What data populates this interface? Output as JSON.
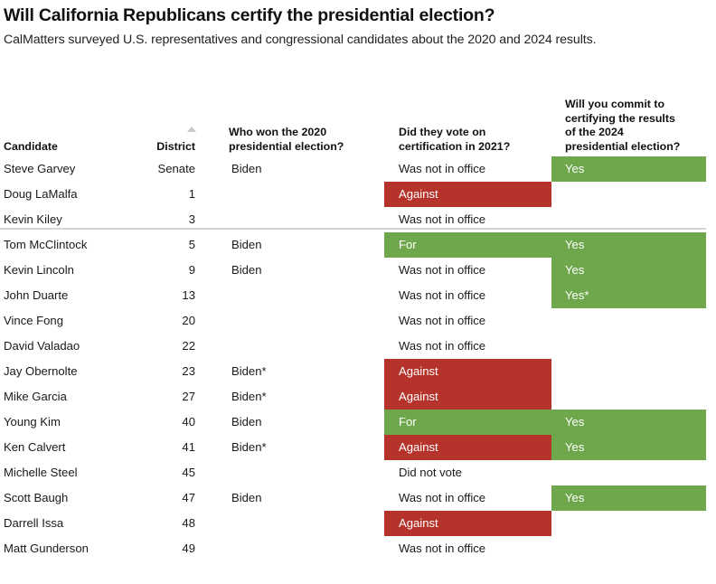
{
  "title": "Will California Republicans certify the presidential election?",
  "subtitle": "CalMatters surveyed U.S. representatives and congressional candidates about the 2020 and 2024 results.",
  "colors": {
    "green": "#6fa74d",
    "red": "#b5332b",
    "rule": "#d5d5d5",
    "sort_caret": "#c9c9c9",
    "text": "#1a1a1a"
  },
  "table": {
    "sort": {
      "column": "District",
      "direction": "ascending",
      "icon": "triangle-up-icon"
    },
    "columns": [
      {
        "key": "candidate",
        "label": "Candidate"
      },
      {
        "key": "district",
        "label": "District"
      },
      {
        "key": "won2020",
        "label": "Who won the 2020 presidential election?"
      },
      {
        "key": "cert2021",
        "label": "Did they vote on certification in 2021?"
      },
      {
        "key": "commit24",
        "label": "Will you commit to certifying the results of the 2024 presidential election?"
      }
    ],
    "column_label_lines": {
      "won2020": [
        "Who won the 2020",
        "presidential election?"
      ],
      "cert2021": [
        "Did they vote on",
        "certification in 2021?"
      ],
      "commit24": [
        "Will you commit to",
        "certifying the results",
        "of the 2024",
        "presidential election?"
      ]
    },
    "rows": [
      {
        "candidate": "Steve Garvey",
        "district": "Senate",
        "won2020": "Biden",
        "cert2021": "Was not in office",
        "cert2021_fill": "none",
        "commit24": "Yes",
        "commit24_fill": "green"
      },
      {
        "candidate": "Doug LaMalfa",
        "district": "1",
        "won2020": "",
        "cert2021": "Against",
        "cert2021_fill": "red",
        "commit24": "",
        "commit24_fill": "none"
      },
      {
        "candidate": "Kevin Kiley",
        "district": "3",
        "won2020": "",
        "cert2021": "Was not in office",
        "cert2021_fill": "none",
        "commit24": "",
        "commit24_fill": "none"
      },
      {
        "candidate": "Tom McClintock",
        "district": "5",
        "won2020": "Biden",
        "cert2021": "For",
        "cert2021_fill": "green",
        "commit24": "Yes",
        "commit24_fill": "green"
      },
      {
        "candidate": "Kevin Lincoln",
        "district": "9",
        "won2020": "Biden",
        "cert2021": "Was not in office",
        "cert2021_fill": "none",
        "commit24": "Yes",
        "commit24_fill": "green"
      },
      {
        "candidate": "John Duarte",
        "district": "13",
        "won2020": "",
        "cert2021": "Was not in office",
        "cert2021_fill": "none",
        "commit24": "Yes*",
        "commit24_fill": "green"
      },
      {
        "candidate": "Vince Fong",
        "district": "20",
        "won2020": "",
        "cert2021": "Was not in office",
        "cert2021_fill": "none",
        "commit24": "",
        "commit24_fill": "none"
      },
      {
        "candidate": "David Valadao",
        "district": "22",
        "won2020": "",
        "cert2021": "Was not in office",
        "cert2021_fill": "none",
        "commit24": "",
        "commit24_fill": "none"
      },
      {
        "candidate": "Jay Obernolte",
        "district": "23",
        "won2020": "Biden*",
        "cert2021": "Against",
        "cert2021_fill": "red",
        "commit24": "",
        "commit24_fill": "none"
      },
      {
        "candidate": "Mike Garcia",
        "district": "27",
        "won2020": "Biden*",
        "cert2021": "Against",
        "cert2021_fill": "red",
        "commit24": "",
        "commit24_fill": "none"
      },
      {
        "candidate": "Young Kim",
        "district": "40",
        "won2020": "Biden",
        "cert2021": "For",
        "cert2021_fill": "green",
        "commit24": "Yes",
        "commit24_fill": "green"
      },
      {
        "candidate": "Ken Calvert",
        "district": "41",
        "won2020": "Biden*",
        "cert2021": "Against",
        "cert2021_fill": "red",
        "commit24": "Yes",
        "commit24_fill": "green"
      },
      {
        "candidate": "Michelle Steel",
        "district": "45",
        "won2020": "",
        "cert2021": "Did not vote",
        "cert2021_fill": "none",
        "commit24": "",
        "commit24_fill": "none"
      },
      {
        "candidate": "Scott Baugh",
        "district": "47",
        "won2020": "Biden",
        "cert2021": "Was not in office",
        "cert2021_fill": "none",
        "commit24": "Yes",
        "commit24_fill": "green"
      },
      {
        "candidate": "Darrell Issa",
        "district": "48",
        "won2020": "",
        "cert2021": "Against",
        "cert2021_fill": "red",
        "commit24": "",
        "commit24_fill": "none"
      },
      {
        "candidate": "Matt Gunderson",
        "district": "49",
        "won2020": "",
        "cert2021": "Was not in office",
        "cert2021_fill": "none",
        "commit24": "",
        "commit24_fill": "none"
      }
    ]
  }
}
